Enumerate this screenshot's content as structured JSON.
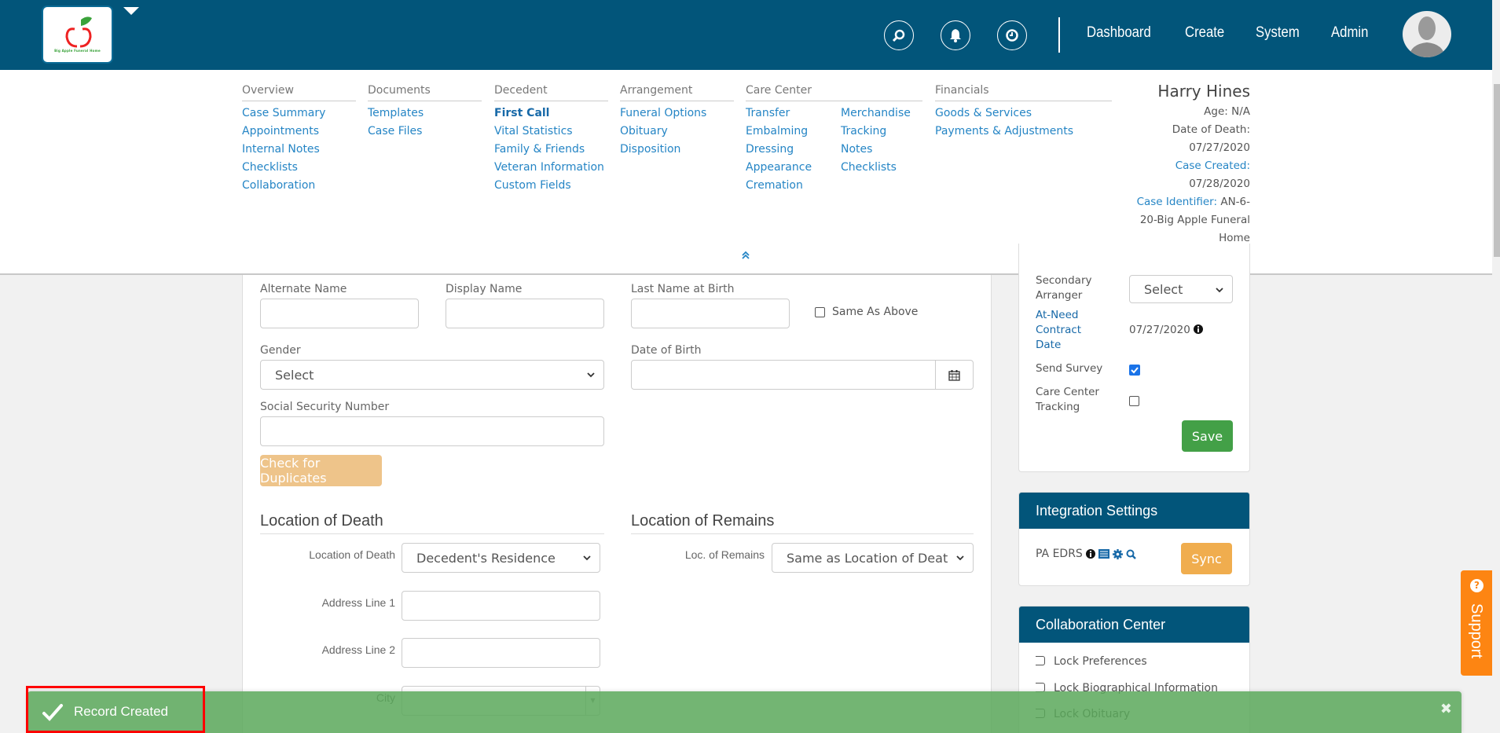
{
  "header": {
    "logo_text": "Big Apple Funeral Home",
    "icons": [
      "search-icon",
      "bell-icon",
      "clock-icon"
    ],
    "nav": [
      "Dashboard",
      "Create",
      "System",
      "Admin"
    ],
    "brand_color": "#02557a"
  },
  "menu": {
    "overview": {
      "title": "Overview",
      "items": [
        "Case Summary",
        "Appointments",
        "Internal Notes",
        "Checklists",
        "Collaboration"
      ]
    },
    "documents": {
      "title": "Documents",
      "items": [
        "Templates",
        "Case Files"
      ]
    },
    "decedent": {
      "title": "Decedent",
      "items": [
        "First Call",
        "Vital Statistics",
        "Family & Friends",
        "Veteran Information",
        "Custom Fields"
      ],
      "active": "First Call"
    },
    "arrangement": {
      "title": "Arrangement",
      "items": [
        "Funeral Options",
        "Obituary",
        "Disposition"
      ]
    },
    "care_center": {
      "title": "Care Center",
      "items_a": [
        "Transfer",
        "Embalming",
        "Dressing",
        "Appearance",
        "Cremation"
      ],
      "items_b": [
        "Merchandise",
        "Tracking",
        "Notes",
        "Checklists"
      ]
    },
    "financials": {
      "title": "Financials",
      "items": [
        "Goods & Services",
        "Payments & Adjustments"
      ]
    }
  },
  "patient": {
    "name": "Harry Hines",
    "age": "Age: N/A",
    "dod_label": "Date of Death:",
    "dod": "07/27/2020",
    "created_label": "Case Created:",
    "created": "07/28/2020",
    "id_label": "Case Identifier:",
    "id_part1": "AN-6-",
    "id_part2": "20-Big Apple Funeral",
    "id_part3": "Home"
  },
  "form": {
    "alternate_name": {
      "label": "Alternate Name",
      "value": ""
    },
    "display_name": {
      "label": "Display Name",
      "value": ""
    },
    "last_name_birth": {
      "label": "Last Name at Birth",
      "value": ""
    },
    "same_as_above": {
      "label": "Same As Above",
      "checked": false
    },
    "gender": {
      "label": "Gender",
      "value": "Select"
    },
    "dob": {
      "label": "Date of Birth",
      "value": ""
    },
    "ssn": {
      "label": "Social Security Number",
      "value": ""
    },
    "check_duplicates": "Check for Duplicates",
    "location_of_death": {
      "section": "Location of Death",
      "field_label": "Location of Death",
      "value": "Decedent's Residence",
      "address1_label": "Address Line 1",
      "address2_label": "Address Line 2",
      "city_label": "City"
    },
    "location_of_remains": {
      "section": "Location of Remains",
      "field_label": "Loc. of Remains",
      "value": "Same as Location of Death"
    }
  },
  "sidebar": {
    "secondary_arranger": {
      "label": "Secondary Arranger",
      "value": "Select"
    },
    "contract_date": {
      "label": "At-Need Contract Date",
      "value": "07/27/2020"
    },
    "send_survey": {
      "label": "Send Survey",
      "checked": true
    },
    "care_center_tracking": {
      "label": "Care Center Tracking",
      "checked": false
    },
    "save": "Save",
    "integration": {
      "title": "Integration Settings",
      "item": "PA EDRS",
      "sync": "Sync"
    },
    "collaboration": {
      "title": "Collaboration Center",
      "items": [
        "Lock Preferences",
        "Lock Biographical Information",
        "Lock Obituary"
      ]
    }
  },
  "support": {
    "label": "Support"
  },
  "toast": {
    "message": "Record Created",
    "close": "✖"
  }
}
